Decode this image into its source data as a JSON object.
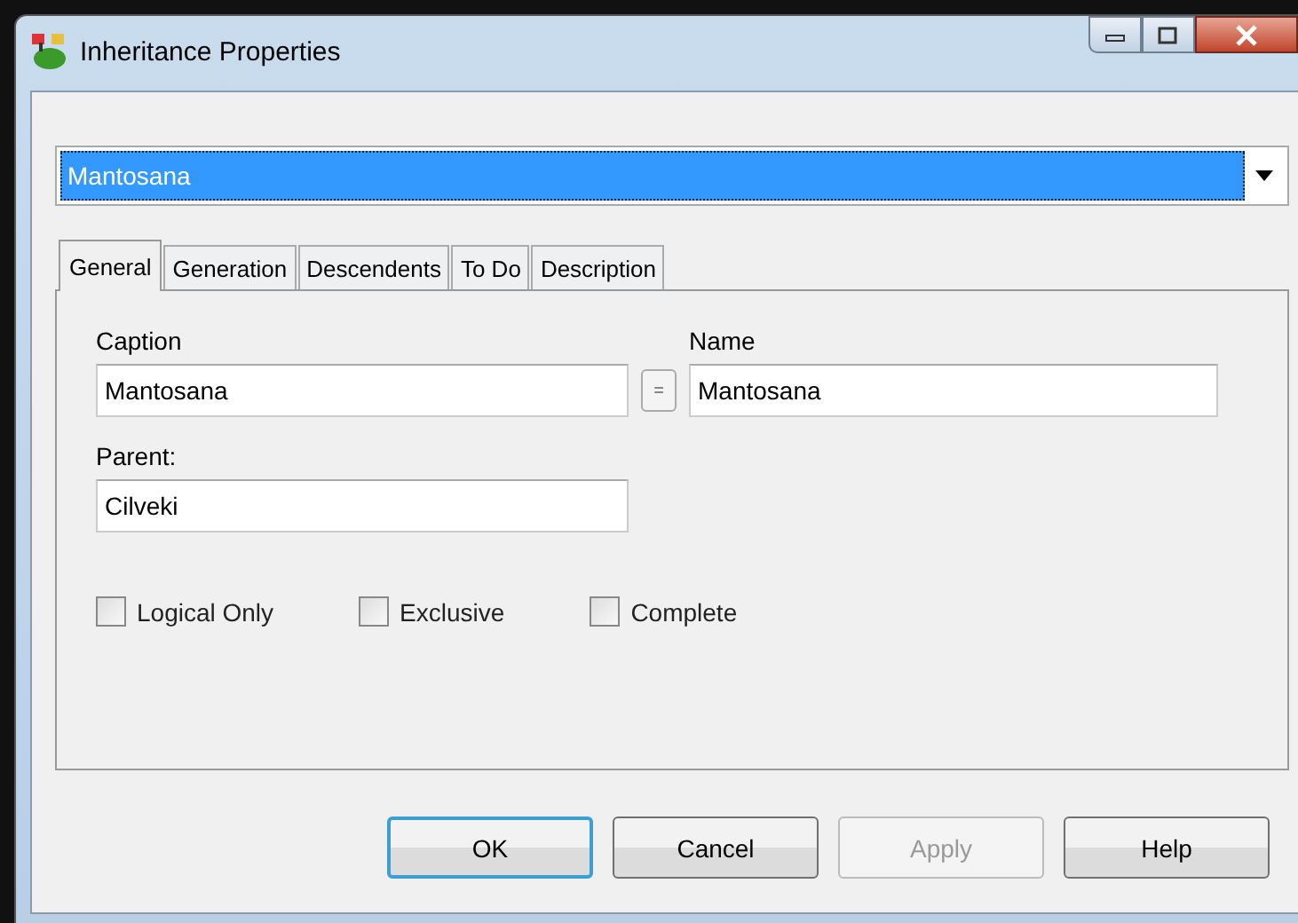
{
  "window": {
    "title": "Inheritance Properties"
  },
  "selector": {
    "value": "Mantosana"
  },
  "tabs": [
    {
      "label": "General",
      "selected": true
    },
    {
      "label": "Generation",
      "selected": false
    },
    {
      "label": "Descendents",
      "selected": false
    },
    {
      "label": "To Do",
      "selected": false
    },
    {
      "label": "Description",
      "selected": false
    }
  ],
  "caption": {
    "label": "Caption",
    "value": "Mantosana"
  },
  "copy_button": {
    "label": "="
  },
  "name": {
    "label": "Name",
    "value": "Mantosana"
  },
  "parent": {
    "label": "Parent:",
    "value": "Cilveki"
  },
  "options": [
    {
      "label": "Logical Only",
      "checked": false
    },
    {
      "label": "Exclusive",
      "checked": false
    },
    {
      "label": "Complete",
      "checked": false
    }
  ],
  "buttons": [
    {
      "label": "OK",
      "default": true,
      "disabled": false
    },
    {
      "label": "Cancel",
      "default": false,
      "disabled": false
    },
    {
      "label": "Apply",
      "default": false,
      "disabled": true
    },
    {
      "label": "Help",
      "default": false,
      "disabled": false
    }
  ]
}
